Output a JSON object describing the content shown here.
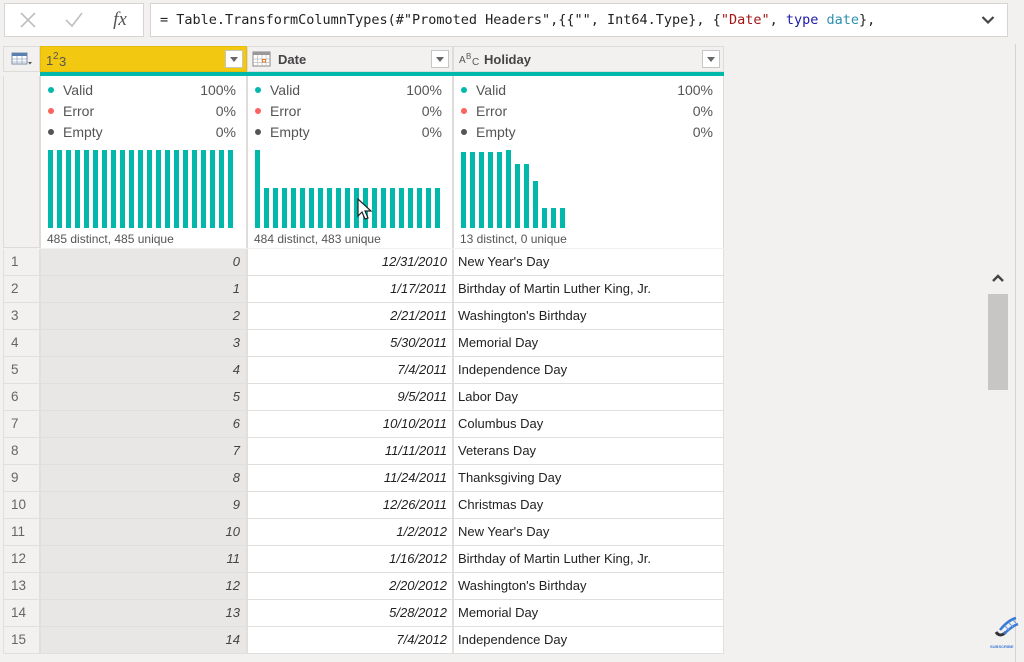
{
  "formula_bar": {
    "cancel_icon": "close-icon",
    "confirm_icon": "check-icon",
    "fx_label": "fx",
    "formula_parts": [
      {
        "text": "= Table.TransformColumnTypes(#\"Promoted Headers\",{{\"\", Int64.Type}, {",
        "cls": ""
      },
      {
        "text": "\"Date\"",
        "cls": "str"
      },
      {
        "text": ", ",
        "cls": ""
      },
      {
        "text": "type",
        "cls": "kw"
      },
      {
        "text": " ",
        "cls": ""
      },
      {
        "text": "date",
        "cls": "typ"
      },
      {
        "text": "},",
        "cls": ""
      }
    ],
    "expand_icon": "chevron-down-icon"
  },
  "columns": [
    {
      "name": "",
      "type_label": "1²3",
      "type": "whole-number",
      "selected": true,
      "stats": {
        "valid": "100%",
        "error": "0%",
        "empty": "0%"
      },
      "distinct_text": "485 distinct, 485 unique",
      "histogram": [
        1,
        1,
        1,
        1,
        1,
        1,
        1,
        1,
        1,
        1,
        1,
        1,
        1,
        1,
        1,
        1,
        1,
        1,
        1,
        1,
        1
      ]
    },
    {
      "name": "Date",
      "type_label": "calendar",
      "type": "date",
      "selected": false,
      "stats": {
        "valid": "100%",
        "error": "0%",
        "empty": "0%"
      },
      "distinct_text": "484 distinct, 483 unique",
      "histogram": [
        2,
        1,
        1,
        1,
        1,
        1,
        1,
        1,
        1,
        1,
        1,
        1,
        1,
        1,
        1,
        1,
        1,
        1,
        1,
        1,
        1
      ]
    },
    {
      "name": "Holiday",
      "type_label": "ABC",
      "type": "text",
      "selected": false,
      "stats": {
        "valid": "100%",
        "error": "0%",
        "empty": "0%"
      },
      "distinct_text": "13 distinct, 0 unique",
      "histogram": [
        39,
        39,
        39,
        39,
        39,
        40,
        33,
        33,
        24,
        10,
        10,
        10
      ]
    }
  ],
  "stat_labels": {
    "valid": "Valid",
    "error": "Error",
    "empty": "Empty"
  },
  "stat_colors": {
    "valid": "#01b8aa",
    "error": "#fd625e",
    "empty": "#555555"
  },
  "accent_color": "#01b8aa",
  "selected_header_color": "#f2c811",
  "rows": [
    {
      "n": "1",
      "idx": "0",
      "date": "12/31/2010",
      "holiday": "New Year's Day"
    },
    {
      "n": "2",
      "idx": "1",
      "date": "1/17/2011",
      "holiday": "Birthday of Martin Luther King, Jr."
    },
    {
      "n": "3",
      "idx": "2",
      "date": "2/21/2011",
      "holiday": "Washington's Birthday"
    },
    {
      "n": "4",
      "idx": "3",
      "date": "5/30/2011",
      "holiday": "Memorial Day"
    },
    {
      "n": "5",
      "idx": "4",
      "date": "7/4/2011",
      "holiday": "Independence Day"
    },
    {
      "n": "6",
      "idx": "5",
      "date": "9/5/2011",
      "holiday": "Labor Day"
    },
    {
      "n": "7",
      "idx": "6",
      "date": "10/10/2011",
      "holiday": "Columbus Day"
    },
    {
      "n": "8",
      "idx": "7",
      "date": "11/11/2011",
      "holiday": "Veterans Day"
    },
    {
      "n": "9",
      "idx": "8",
      "date": "11/24/2011",
      "holiday": "Thanksgiving Day"
    },
    {
      "n": "10",
      "idx": "9",
      "date": "12/26/2011",
      "holiday": "Christmas Day"
    },
    {
      "n": "11",
      "idx": "10",
      "date": "1/2/2012",
      "holiday": "New Year's Day"
    },
    {
      "n": "12",
      "idx": "11",
      "date": "1/16/2012",
      "holiday": "Birthday of Martin Luther King, Jr."
    },
    {
      "n": "13",
      "idx": "12",
      "date": "2/20/2012",
      "holiday": "Washington's Birthday"
    },
    {
      "n": "14",
      "idx": "13",
      "date": "5/28/2012",
      "holiday": "Memorial Day"
    },
    {
      "n": "15",
      "idx": "14",
      "date": "7/4/2012",
      "holiday": "Independence Day"
    }
  ],
  "watermark": {
    "label": "SUBSCRIBE",
    "icon": "dna-logo-icon"
  }
}
